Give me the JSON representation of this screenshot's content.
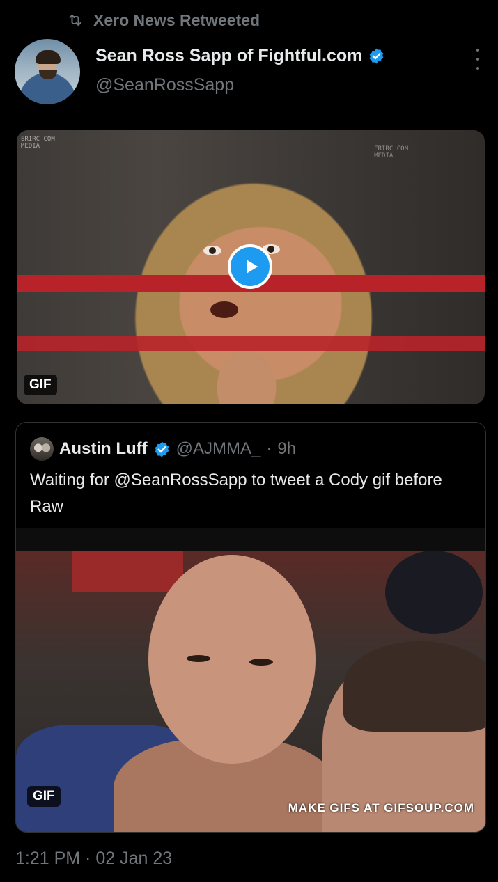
{
  "retweet": {
    "icon": "retweet-icon",
    "label": "Xero News Retweeted"
  },
  "tweet": {
    "author_name": "Sean Ross Sapp of Fightful.com",
    "author_handle": "@SeanRossSapp",
    "verified": true,
    "media": {
      "badge": "GIF",
      "watermark_left": "ERIRC COM\nMEDIA",
      "watermark_right": "ERIRC COM\nMEDIA"
    }
  },
  "quote": {
    "author_name": "Austin Luff",
    "author_handle": "@AJMMA_",
    "separator": "·",
    "time": "9h",
    "verified": true,
    "text": "Waiting for @SeanRossSapp to tweet a Cody gif before Raw",
    "media": {
      "badge": "GIF",
      "watermark": "MAKE GIFS AT GIFSOUP.COM"
    }
  },
  "timestamp": "1:21 PM · 02 Jan 23",
  "colors": {
    "accent": "#1d9bf0",
    "secondary_text": "#71767b",
    "background": "#000000"
  }
}
